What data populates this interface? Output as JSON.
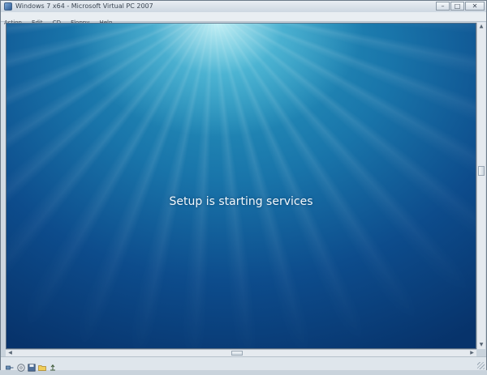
{
  "window": {
    "title": "Windows 7 x64 - Microsoft Virtual PC 2007",
    "minimize_label": "–",
    "maximize_label": "□",
    "close_label": "✕"
  },
  "menu": {
    "items": [
      "Action",
      "Edit",
      "CD",
      "Floppy",
      "Help"
    ]
  },
  "screen": {
    "message": "Setup is starting services"
  },
  "scrollbars": {
    "up": "▲",
    "down": "▼",
    "left": "◀",
    "right": "▶"
  },
  "statusbar": {
    "icons": [
      "network-icon",
      "cd-icon",
      "floppy-icon",
      "shared-folder-icon",
      "usb-icon"
    ]
  }
}
